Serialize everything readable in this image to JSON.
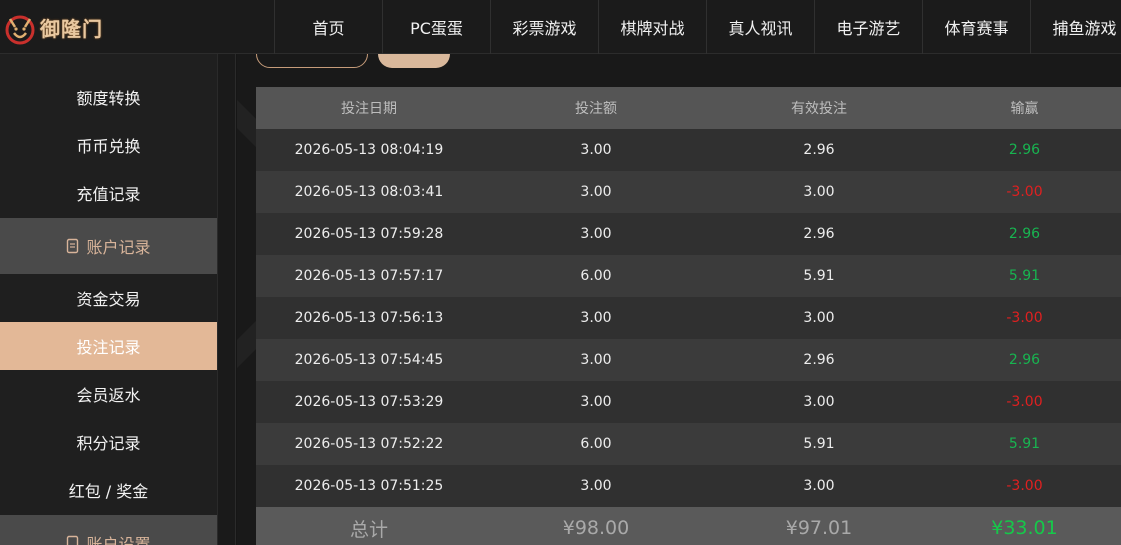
{
  "brand": {
    "name": "御隆门"
  },
  "nav": [
    "首页",
    "PC蛋蛋",
    "彩票游戏",
    "棋牌对战",
    "真人视讯",
    "电子游艺",
    "体育赛事",
    "捕鱼游戏"
  ],
  "sidebar": {
    "items_top": [
      "额度转换",
      "币币兑换",
      "充值记录"
    ],
    "group_account_records": "账户记录",
    "items_records": [
      "资金交易",
      "投注记录",
      "会员返水",
      "积分记录",
      "红包 / 奖金"
    ],
    "group_account_settings": "账户设置"
  },
  "table": {
    "headers": [
      "投注日期",
      "投注额",
      "有效投注",
      "输赢"
    ],
    "rows": [
      [
        "2026-05-13 08:04:19",
        "3.00",
        "2.96",
        "2.96"
      ],
      [
        "2026-05-13 08:03:41",
        "3.00",
        "3.00",
        "-3.00"
      ],
      [
        "2026-05-13 07:59:28",
        "3.00",
        "2.96",
        "2.96"
      ],
      [
        "2026-05-13 07:57:17",
        "6.00",
        "5.91",
        "5.91"
      ],
      [
        "2026-05-13 07:56:13",
        "3.00",
        "3.00",
        "-3.00"
      ],
      [
        "2026-05-13 07:54:45",
        "3.00",
        "2.96",
        "2.96"
      ],
      [
        "2026-05-13 07:53:29",
        "3.00",
        "3.00",
        "-3.00"
      ],
      [
        "2026-05-13 07:52:22",
        "6.00",
        "5.91",
        "5.91"
      ],
      [
        "2026-05-13 07:51:25",
        "3.00",
        "3.00",
        "-3.00"
      ]
    ],
    "footer": [
      "总计",
      "¥98.00",
      "¥97.01",
      "¥33.01"
    ]
  },
  "colors": {
    "accent": "#e3b897",
    "win": "#18b450",
    "loss": "#e02020"
  }
}
